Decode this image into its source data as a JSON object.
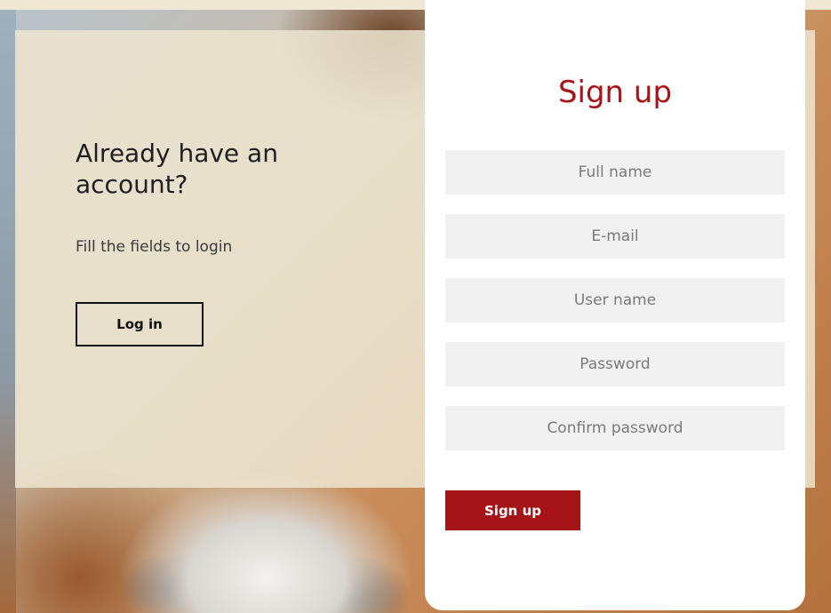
{
  "login_panel": {
    "title": "Already have an account?",
    "subtitle": "Fill the fields to login",
    "login_button": "Log in"
  },
  "signup_form": {
    "title": "Sign up",
    "fields": [
      {
        "placeholder": "Full name",
        "value": ""
      },
      {
        "placeholder": "E-mail",
        "value": ""
      },
      {
        "placeholder": "User name",
        "value": ""
      },
      {
        "placeholder": "Password",
        "value": ""
      },
      {
        "placeholder": "Confirm password",
        "value": ""
      }
    ],
    "submit_button": "Sign up"
  },
  "colors": {
    "accent": "#a51517",
    "panel": "#ece5d1",
    "field_bg": "#f1f1f1"
  }
}
